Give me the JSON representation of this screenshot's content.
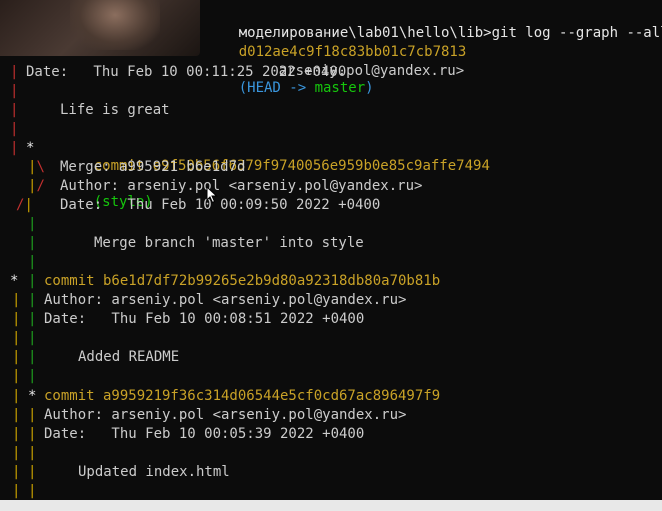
{
  "terminal": {
    "prompt_line": "моделирование\\lab01\\hello\\lib>git log --graph --all",
    "head_line_hash": "d012ae4c9f18c83bb01c7cb7813",
    "head_ref_open": "(HEAD -> ",
    "head_ref_branch": "master",
    "head_ref_close": ")",
    "author_email_partial": "arseniy.pol@yandex.ru>",
    "date1": "Date:   Thu Feb 10 00:11:25 2022 +0400",
    "msg1": "Life is great",
    "commit2_label": "commit e9f50b56f6379f9740056e959b0e85c9affe7494",
    "commit2_branch": "(style)",
    "merge2": "Merge: a995921 b6e1d7d",
    "author2": "Author: arseniy.pol <arseniy.pol@yandex.ru>",
    "date2": "Date:   Thu Feb 10 00:09:50 2022 +0400",
    "msg2": "Merge branch 'master' into style",
    "commit3_label": "commit b6e1d7df72b99265e2b9d80a92318db80a70b81b",
    "author3": "Author: arseniy.pol <arseniy.pol@yandex.ru>",
    "date3": "Date:   Thu Feb 10 00:08:51 2022 +0400",
    "msg3": "Added README",
    "commit4_label": "commit a9959219f36c314d06544e5cf0cd67ac896497f9",
    "author4": "Author: arseniy.pol <arseniy.pol@yandex.ru>",
    "date4": "Date:   Thu Feb 10 00:05:39 2022 +0400",
    "msg4": "Updated index.html"
  },
  "graph": {
    "bar": "|",
    "star": "*",
    "backslash": "\\",
    "slash": "/"
  },
  "icons": {
    "mouse_pointer": "mouse-pointer-icon"
  },
  "colors": {
    "background": "#0c0c0c",
    "text": "#cccccc",
    "commit_yellow": "#c9a227",
    "head_cyan": "#3a96dd",
    "branch_green": "#16c60c",
    "graph_red": "#c2302f",
    "graph_yellow": "#c8a000"
  }
}
